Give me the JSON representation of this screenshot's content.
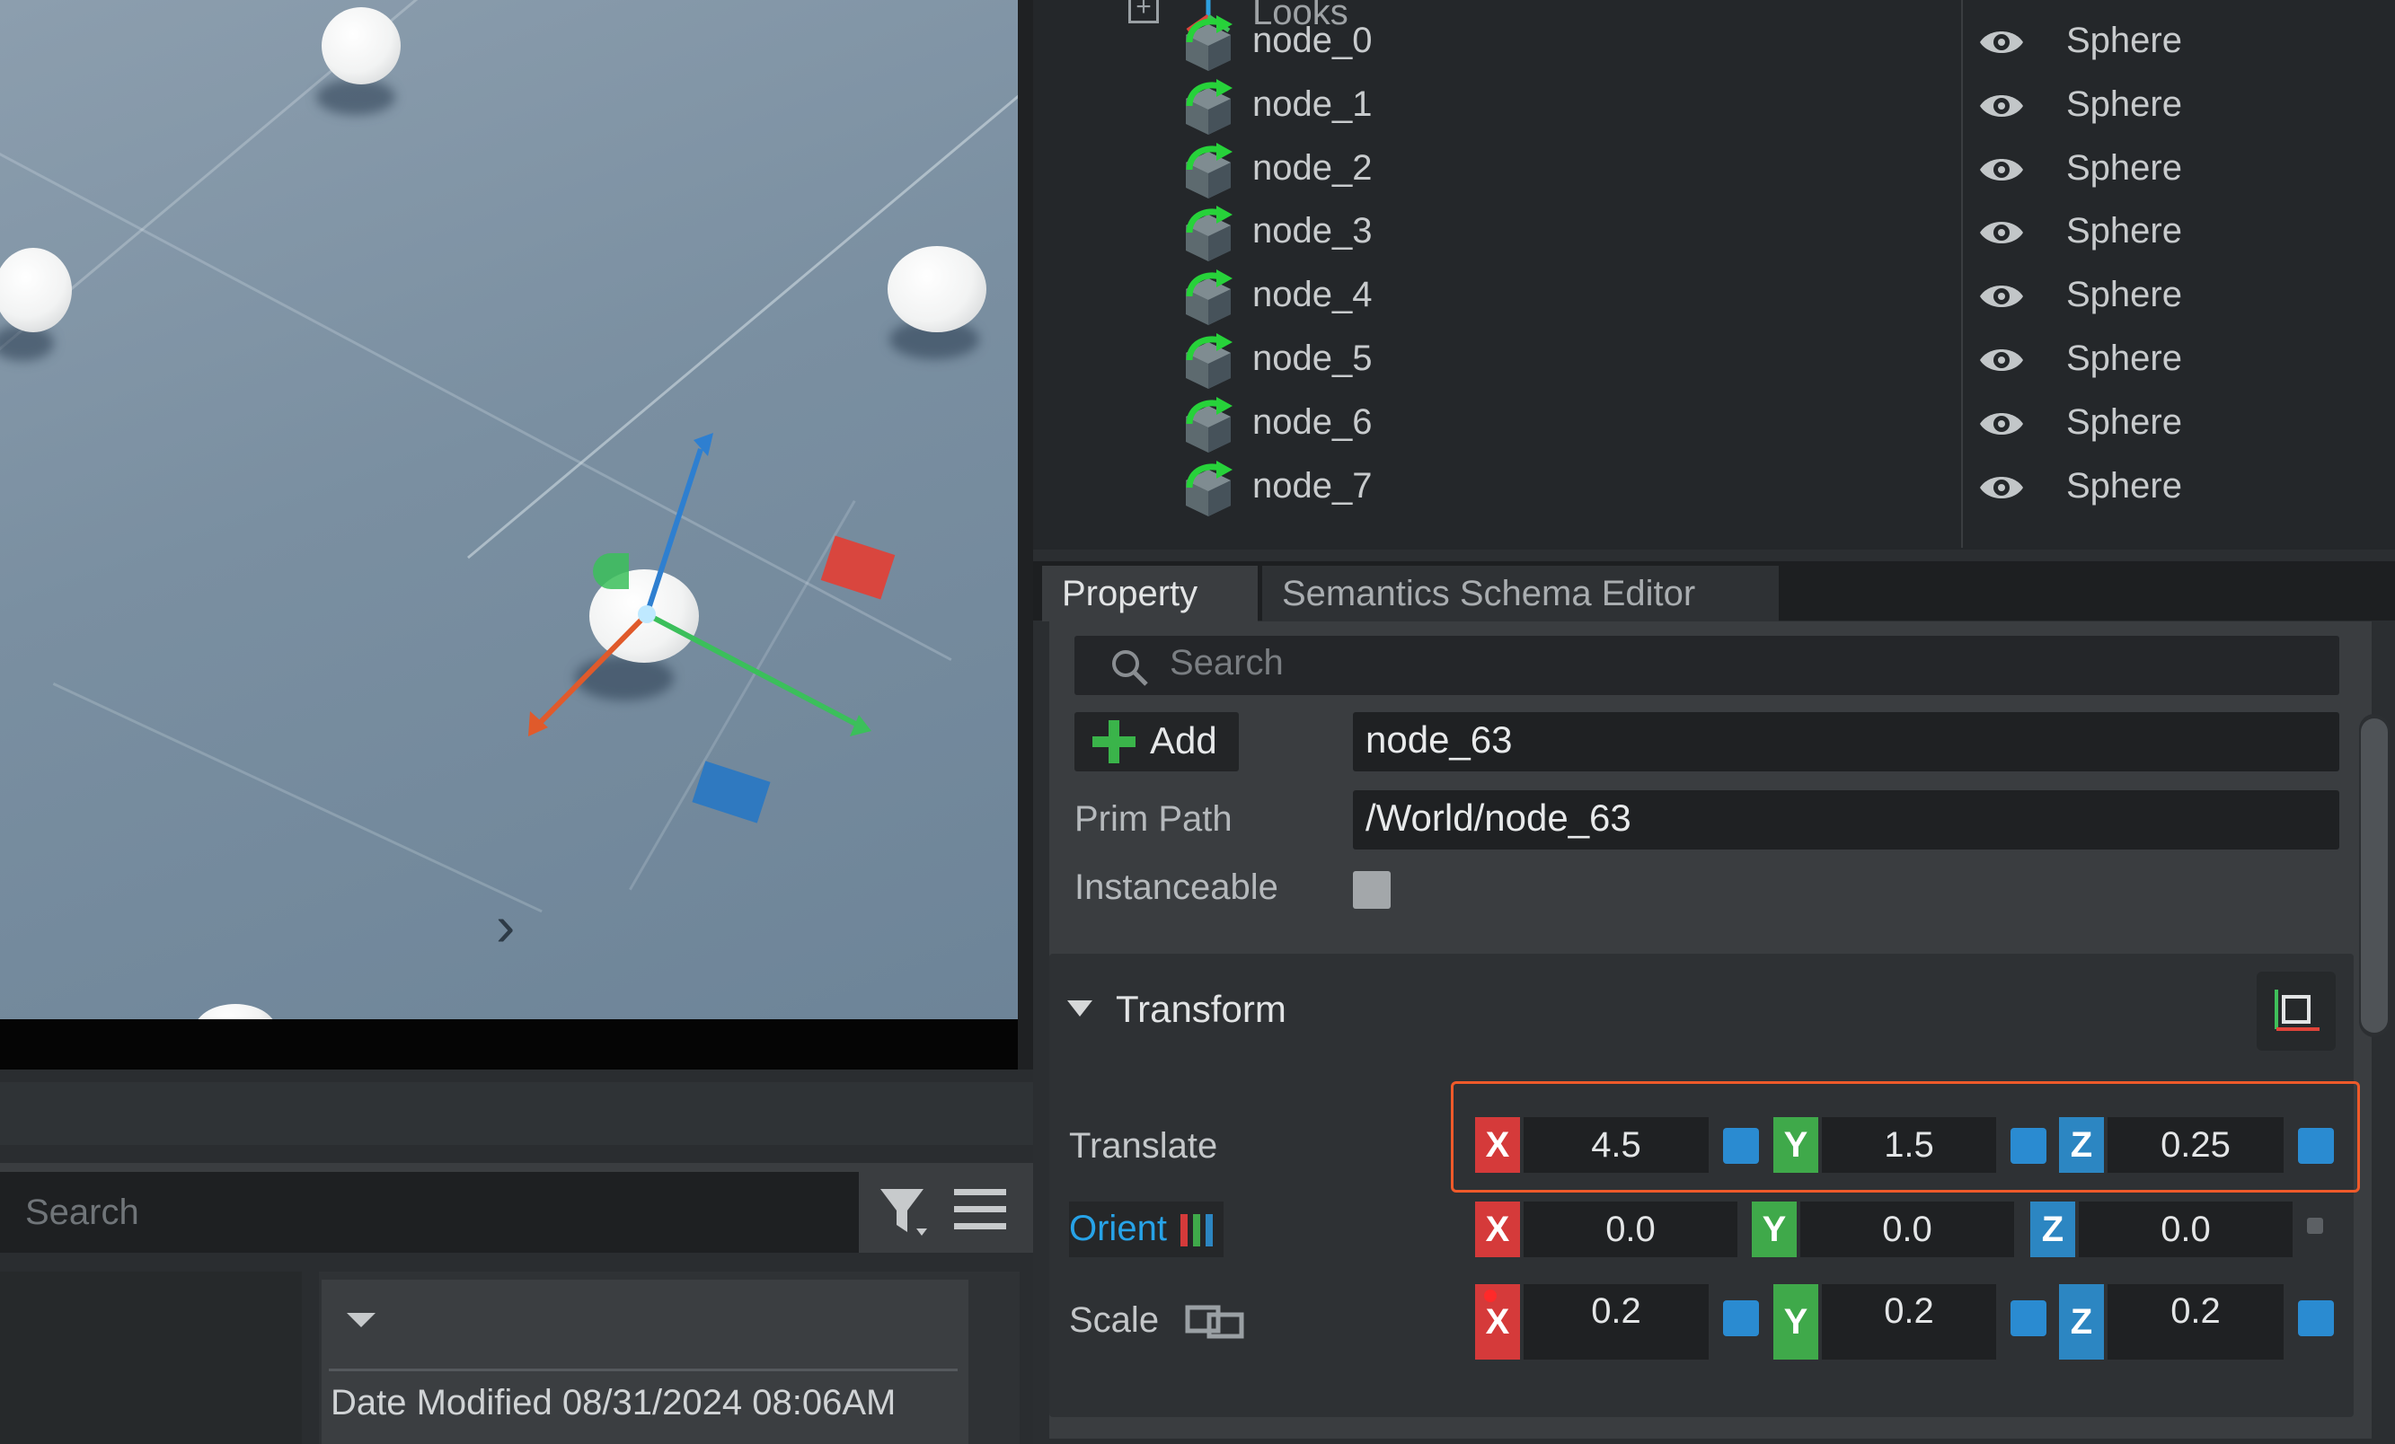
{
  "stage": {
    "header_label": "Looks",
    "rows": [
      {
        "name": "node_0",
        "type": "Sphere"
      },
      {
        "name": "node_1",
        "type": "Sphere"
      },
      {
        "name": "node_2",
        "type": "Sphere"
      },
      {
        "name": "node_3",
        "type": "Sphere"
      },
      {
        "name": "node_4",
        "type": "Sphere"
      },
      {
        "name": "node_5",
        "type": "Sphere"
      },
      {
        "name": "node_6",
        "type": "Sphere"
      },
      {
        "name": "node_7",
        "type": "Sphere"
      }
    ]
  },
  "property": {
    "tabs": [
      "Property",
      "Semantics Schema Editor"
    ],
    "search_placeholder": "Search",
    "add_label": "Add",
    "name_value": "node_63",
    "prim_path_label": "Prim Path",
    "prim_path_value": "/World/node_63",
    "instanceable_label": "Instanceable",
    "transform": {
      "title": "Transform",
      "translate_label": "Translate",
      "translate": {
        "x": "4.5",
        "y": "1.5",
        "z": "0.25"
      },
      "orient_label": "Orient",
      "orient": {
        "x": "0.0",
        "y": "0.0",
        "z": "0.0"
      },
      "scale_label": "Scale",
      "scale": {
        "x": "0.2",
        "y": "0.2",
        "z": "0.2"
      },
      "axis_labels": {
        "x": "X",
        "y": "Y",
        "z": "Z"
      }
    }
  },
  "content": {
    "search_placeholder": "Search",
    "date_modified": "Date Modified 08/31/2024 08:06AM"
  },
  "colors": {
    "axis_x": "#d53a3a",
    "axis_y": "#3fa94a",
    "axis_z": "#2c86c2",
    "highlight": "#ef5a2a",
    "orient_text": "#27a3e8"
  }
}
